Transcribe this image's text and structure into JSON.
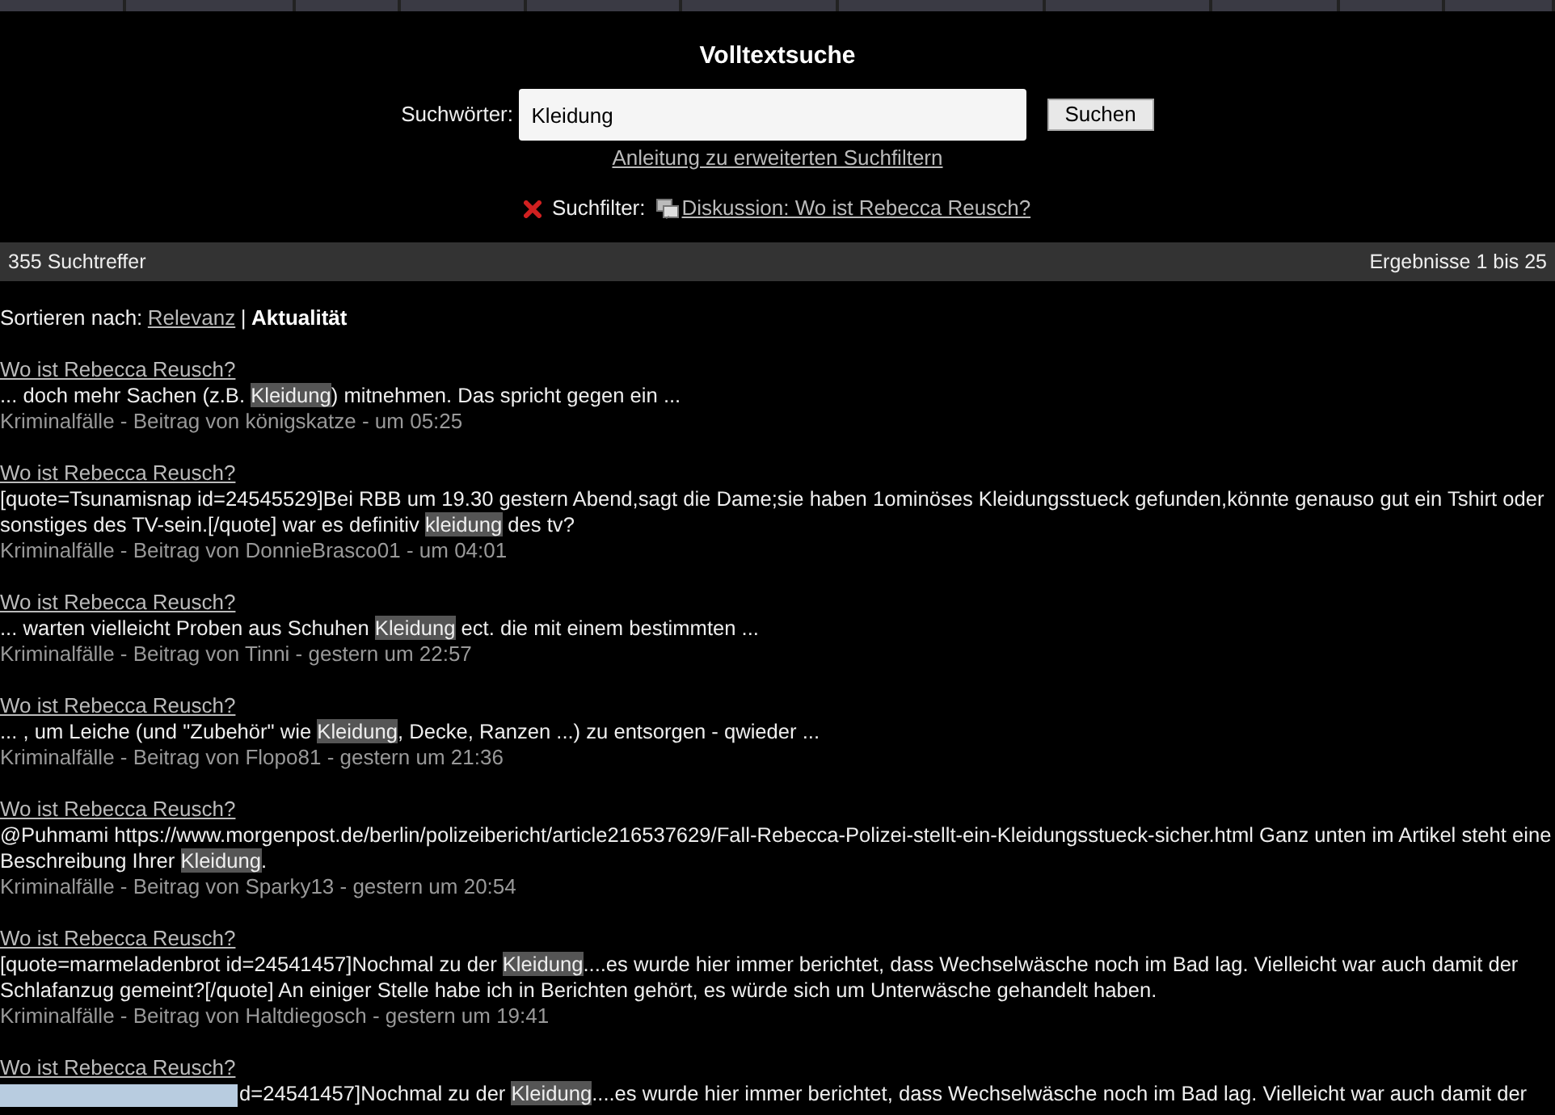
{
  "title": "Volltextsuche",
  "search": {
    "label": "Suchwörter:",
    "value": "Kleidung",
    "button": "Suchen"
  },
  "help_link": "Anleitung zu erweiterten Suchfiltern",
  "filter": {
    "label": "Suchfilter:",
    "link": "Diskussion: Wo ist Rebecca Reusch?"
  },
  "results_bar": {
    "count": "355 Suchtreffer",
    "range": "Ergebnisse 1 bis 25"
  },
  "sort": {
    "label": "Sortieren nach:",
    "separator": "|",
    "options": [
      {
        "label": "Relevanz",
        "selected": false
      },
      {
        "label": "Aktualität",
        "selected": true
      }
    ]
  },
  "results": [
    {
      "title": "Wo ist Rebecca Reusch?",
      "snippet": [
        {
          "text": "... doch mehr Sachen (z.B. ",
          "highlight": false
        },
        {
          "text": "Kleidung",
          "highlight": true
        },
        {
          "text": ") mitnehmen. Das spricht gegen ein ...",
          "highlight": false
        }
      ],
      "meta": "Kriminalfälle - Beitrag von königskatze - um 05:25"
    },
    {
      "title": "Wo ist Rebecca Reusch?",
      "snippet": [
        {
          "text": "[quote=Tsunamisnap id=24545529]Bei RBB um 19.30 gestern Abend,sagt die Dame;sie haben 1ominöses Kleidungsstueck gefunden,könnte genauso gut ein Tshirt oder sonstiges des TV-sein.[/quote] war es definitiv ",
          "highlight": false
        },
        {
          "text": "kleidung",
          "highlight": true
        },
        {
          "text": " des tv?",
          "highlight": false
        }
      ],
      "meta": "Kriminalfälle - Beitrag von DonnieBrasco01 - um 04:01"
    },
    {
      "title": "Wo ist Rebecca Reusch?",
      "snippet": [
        {
          "text": "... warten vielleicht Proben aus Schuhen ",
          "highlight": false
        },
        {
          "text": "Kleidung",
          "highlight": true
        },
        {
          "text": " ect. die mit einem bestimmten ...",
          "highlight": false
        }
      ],
      "meta": "Kriminalfälle - Beitrag von Tinni - gestern um 22:57"
    },
    {
      "title": "Wo ist Rebecca Reusch?",
      "snippet": [
        {
          "text": "... , um Leiche (und \"Zubehör\" wie ",
          "highlight": false
        },
        {
          "text": "Kleidung",
          "highlight": true
        },
        {
          "text": ", Decke, Ranzen ...) zu entsorgen - qwieder ...",
          "highlight": false
        }
      ],
      "meta": "Kriminalfälle - Beitrag von Flopo81 - gestern um 21:36"
    },
    {
      "title": "Wo ist Rebecca Reusch?",
      "snippet": [
        {
          "text": "@Puhmami https://www.morgenpost.de/berlin/polizeibericht/article216537629/Fall-Rebecca-Polizei-stellt-ein-Kleidungsstueck-sicher.html Ganz unten im Artikel steht eine Beschreibung Ihrer ",
          "highlight": false
        },
        {
          "text": "Kleidung",
          "highlight": true
        },
        {
          "text": ".",
          "highlight": false
        }
      ],
      "meta": "Kriminalfälle - Beitrag von Sparky13 - gestern um 20:54"
    },
    {
      "title": "Wo ist Rebecca Reusch?",
      "snippet": [
        {
          "text": "[quote=marmeladenbrot id=24541457]Nochmal zu der ",
          "highlight": false
        },
        {
          "text": "Kleidung",
          "highlight": true
        },
        {
          "text": "....es wurde hier immer berichtet, dass Wechselwäsche noch im Bad lag. Vielleicht war auch damit der Schlafanzug gemeint?[/quote] An einiger Stelle habe ich in Berichten gehört, es würde sich um Unterwäsche gehandelt haben.",
          "highlight": false
        }
      ],
      "meta": "Kriminalfälle - Beitrag von Haltdiegosch - gestern um 19:41"
    },
    {
      "title": "Wo ist Rebecca Reusch?",
      "covered": true,
      "snippet": [
        {
          "text": "d=24541457]Nochmal zu der ",
          "highlight": false
        },
        {
          "text": "Kleidung",
          "highlight": true
        },
        {
          "text": "....es wurde hier immer berichtet, dass Wechselwäsche noch im Bad lag. Vielleicht war auch damit der",
          "highlight": false
        }
      ]
    }
  ]
}
